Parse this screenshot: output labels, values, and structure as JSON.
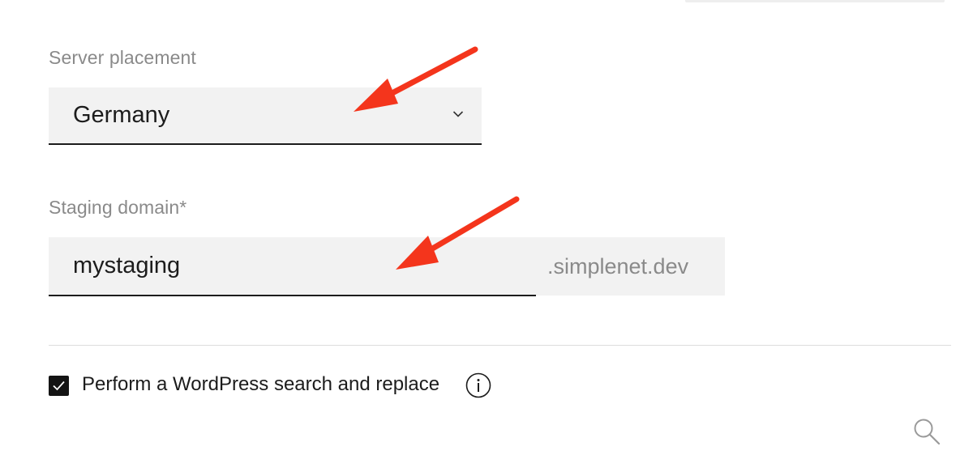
{
  "server_placement": {
    "label": "Server placement",
    "selected": "Germany"
  },
  "staging_domain": {
    "label": "Staging domain*",
    "value": "mystaging",
    "suffix": ".simplenet.dev"
  },
  "search_replace": {
    "label": "Perform a WordPress search and replace",
    "checked": true
  },
  "icons": {
    "select_chevron": "chevron-down-icon",
    "info": "info-icon",
    "search": "search-icon",
    "check": "checkmark-icon"
  },
  "colors": {
    "annotation_arrow": "#f4351c",
    "field_background": "#f2f2f2",
    "label_text": "#8a8a8a",
    "checkbox_fill": "#141414"
  }
}
